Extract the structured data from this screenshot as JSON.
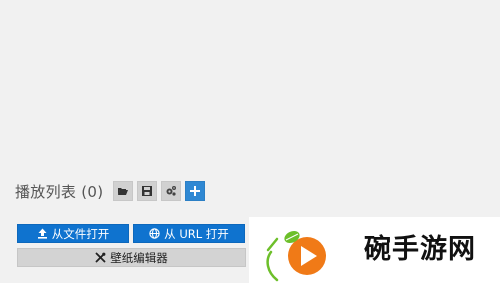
{
  "playlist": {
    "title": "播放列表 (0)",
    "tools": [
      {
        "name": "open-folder-icon"
      },
      {
        "name": "save-icon"
      },
      {
        "name": "settings-icon"
      },
      {
        "name": "add-icon"
      }
    ]
  },
  "actions": {
    "open_file_label": "从文件打开",
    "open_url_label": "从 URL 打开",
    "wallpaper_editor_label": "壁纸编辑器"
  },
  "watermark": {
    "text": "碗手游网"
  },
  "colors": {
    "background": "#f1f1f1",
    "primary": "#0f73cf",
    "secondary": "#d3d3d3",
    "accent_add": "#2f88d3",
    "logo_orange": "#f07a17",
    "logo_green": "#6dbf2a"
  }
}
